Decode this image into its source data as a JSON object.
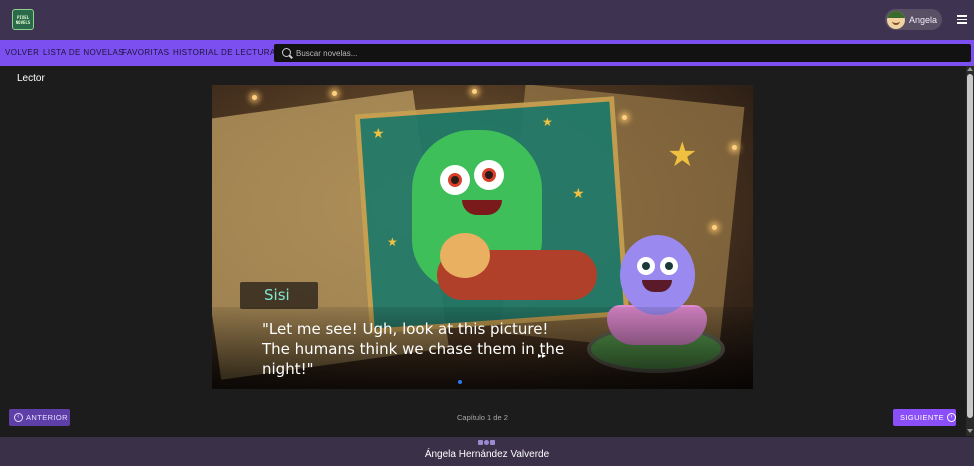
{
  "header": {
    "logo_text_line1": "PIXEL",
    "logo_text_line2": "NOVELS",
    "user_name": "Angela"
  },
  "nav": {
    "items": [
      {
        "label": "VOLVER"
      },
      {
        "label": "LISTA DE NOVELAS"
      },
      {
        "label": "FAVORITAS"
      },
      {
        "label": "HISTORIAL DE LECTURAS"
      }
    ]
  },
  "search": {
    "placeholder": "Buscar novelas...",
    "value": ""
  },
  "page": {
    "title": "Lector"
  },
  "reader": {
    "speaker": "Sisi",
    "dialogue": "\"Let me see! Ugh, look at this picture! The humans think we chase them in the night!\"",
    "continue_mark": "▸▸"
  },
  "controls": {
    "prev_label": "ANTERIOR",
    "next_label": "SIGUIENTE",
    "chapter_info": "Capítulo 1 de 2"
  },
  "footer": {
    "author": "Ángela Hernández Valverde"
  },
  "colors": {
    "topbar": "#3e3350",
    "navbar": "#7c4ff0",
    "accent": "#8a4ff8",
    "background": "#1c1c1c"
  }
}
